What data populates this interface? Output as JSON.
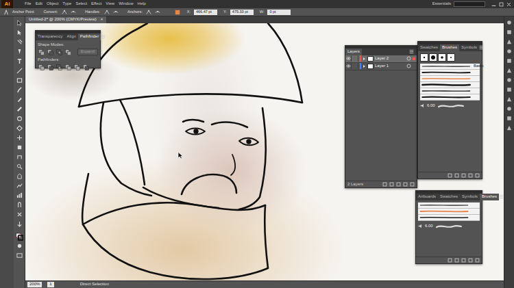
{
  "app": {
    "logo": "Ai"
  },
  "menu": [
    "File",
    "Edit",
    "Object",
    "Type",
    "Select",
    "Effect",
    "View",
    "Window",
    "Help"
  ],
  "workspace": {
    "label": "Essentials"
  },
  "control_bar": {
    "tool": "Anchor Point",
    "groups": [
      "Convert:",
      "Handles:",
      "Anchors:"
    ],
    "fields": [
      {
        "label": "X:",
        "value": "466.47 pt"
      },
      {
        "label": "Y:",
        "value": "475.33 pt"
      },
      {
        "label": "W:",
        "value": "0 pt"
      }
    ]
  },
  "document": {
    "tab": "Untitled-2* @ 200% (CMYK/Preview)",
    "close": "×"
  },
  "pathfinder_panel": {
    "tabs": [
      {
        "label": "Transparency",
        "selected": false
      },
      {
        "label": "Align",
        "selected": false
      },
      {
        "label": "Pathfinder",
        "selected": true
      }
    ],
    "shape_modes": "Shape Modes:",
    "expand": "Expand",
    "pathfinders": "Pathfinders:"
  },
  "layers_panel": {
    "tabs": [
      {
        "label": "Layers",
        "selected": true
      }
    ],
    "layers": [
      {
        "name": "Layer 2",
        "visible": true,
        "selected": true,
        "color": "#ff4f4f"
      },
      {
        "name": "Layer 1",
        "visible": true,
        "selected": false,
        "color": "#4f7dff"
      }
    ],
    "footer": "2 Layers"
  },
  "brushes_panel": {
    "tabs": [
      {
        "label": "Swatches",
        "selected": false
      },
      {
        "label": "Brushes",
        "selected": true
      },
      {
        "label": "Symbols",
        "selected": false
      }
    ],
    "preset_label": "Basic",
    "size": "6.00",
    "strokes": [
      {
        "color": "#1a1a1a"
      },
      {
        "color": "#1a1a1a"
      },
      {
        "color": "#e8864a"
      },
      {
        "color": "#1a1a1a"
      },
      {
        "color": "#1a1a1a"
      },
      {
        "color": "#1a1a1a"
      }
    ]
  },
  "brushes_panel_2": {
    "tabs": [
      {
        "label": "Artboards",
        "selected": false
      },
      {
        "label": "Swatches",
        "selected": false
      },
      {
        "label": "Symbols",
        "selected": false
      },
      {
        "label": "Brushes",
        "selected": true
      }
    ],
    "size": "6.00",
    "strokes": [
      {
        "color": "#1a1a1a"
      },
      {
        "color": "#e8864a"
      },
      {
        "color": "#1a1a1a"
      }
    ]
  },
  "status_bar": {
    "zoom": "200%",
    "artboard": "1",
    "tool": "Direct Selection"
  }
}
